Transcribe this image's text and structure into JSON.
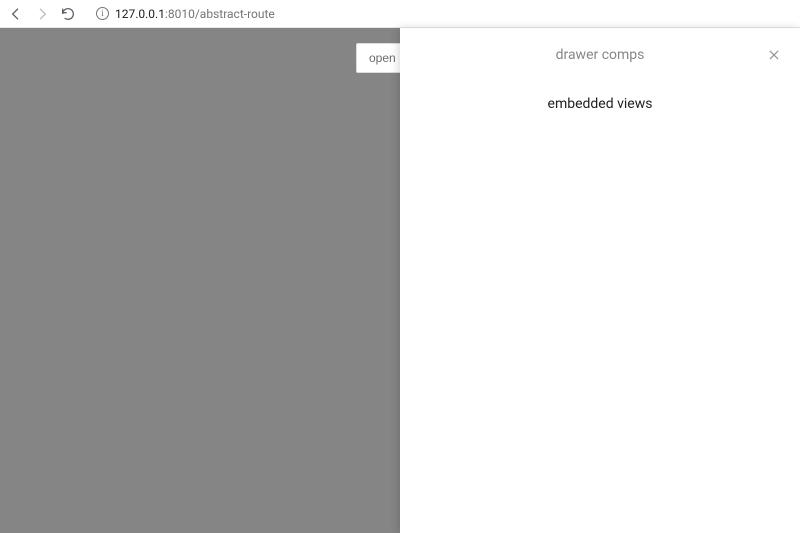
{
  "browser": {
    "url_host": "127.0.0.1",
    "url_port_path": ":8010/abstract-route"
  },
  "page": {
    "open_button_label": "open"
  },
  "drawer": {
    "title": "drawer comps",
    "content": "embedded views"
  }
}
